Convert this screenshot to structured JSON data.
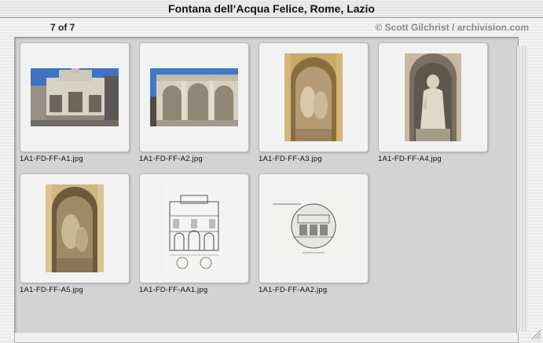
{
  "window": {
    "title": "Fontana dell’Acqua Felice, Rome, Lazio"
  },
  "header": {
    "counter": "7 of 7",
    "credit": "© Scott Gilchrist / archivision.com"
  },
  "thumbnails": [
    {
      "filename": "1A1-FD-FF-A1.jpg",
      "subject": "fountain-facade-photo"
    },
    {
      "filename": "1A1-FD-FF-A2.jpg",
      "subject": "fountain-arches-photo"
    },
    {
      "filename": "1A1-FD-FF-A3.jpg",
      "subject": "niche-relief-photo"
    },
    {
      "filename": "1A1-FD-FF-A4.jpg",
      "subject": "moses-statue-photo"
    },
    {
      "filename": "1A1-FD-FF-A5.jpg",
      "subject": "niche-relief-photo"
    },
    {
      "filename": "1A1-FD-FF-AA1.jpg",
      "subject": "engraving-elevation"
    },
    {
      "filename": "1A1-FD-FF-AA2.jpg",
      "subject": "engraving-section-drawing"
    }
  ],
  "colors": {
    "title_text": "#111111",
    "credit_text": "#8a8a8a",
    "panel_background": "#d3d3d3",
    "thumbnail_frame": "#f2f2f2"
  }
}
